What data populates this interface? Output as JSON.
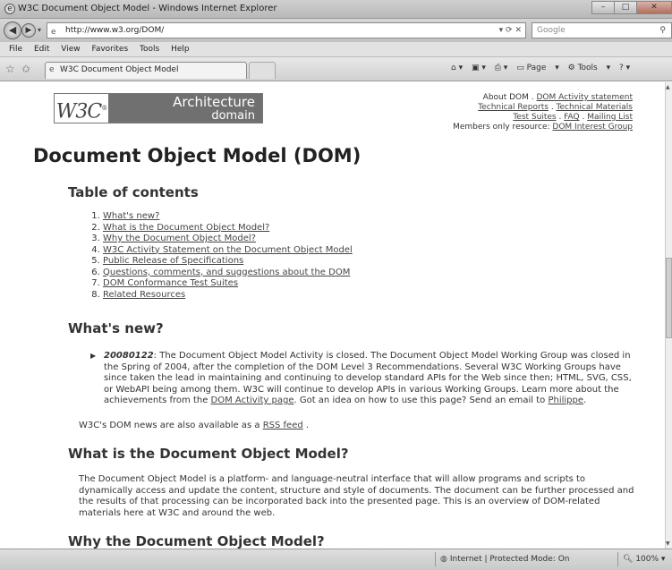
{
  "window": {
    "title": "W3C Document Object Model - Windows Internet Explorer",
    "controls": [
      "–",
      "□",
      "✕"
    ]
  },
  "address_bar": {
    "url": "http://www.w3.org/DOM/",
    "search_placeholder": "Google"
  },
  "menu": [
    "File",
    "Edit",
    "View",
    "Favorites",
    "Tools",
    "Help"
  ],
  "tab": {
    "label": "W3C Document Object Model"
  },
  "command_bar": {
    "page_label": "Page",
    "tools_label": "Tools"
  },
  "page": {
    "logo": {
      "w3c": "W3C",
      "line1": "Architecture",
      "line2": "domain"
    },
    "top_links": {
      "about": "About DOM",
      "activity": "DOM Activity statement",
      "tech_reports": "Technical Reports",
      "tech_materials": "Technical Materials",
      "test_suites": "Test Suites",
      "faq": "FAQ",
      "mailing": "Mailing List",
      "members_label": "Members only resource:",
      "interest_group": "DOM Interest Group"
    },
    "title": "Document Object Model (DOM)",
    "toc_heading": "Table of contents",
    "toc": [
      "What's new?",
      "What is the Document Object Model?",
      "Why the Document Object Model?",
      "W3C Activity Statement on the Document Object Model",
      "Public Release of Specifications",
      "Questions, comments, and suggestions about the DOM",
      "DOM Conformance Test Suites",
      "Related Resources"
    ],
    "whats_new_heading": "What's new?",
    "news": {
      "date": "20080122",
      "text1": ": The Document Object Model Activity is closed. The Document Object Model Working Group was closed in the Spring of 2004, after the completion of the DOM Level 3 Recommendations. Several W3C Working Groups have since taken the lead in maintaining and continuing to develop standard APIs for the Web since then; HTML, SVG, CSS, or WebAPI being among them. W3C will continue to develop APIs in various Working Groups. Learn more about the achievements from the ",
      "link1": "DOM Activity page",
      "text2": ". Got an idea on how to use this page? Send an email to ",
      "link2": "Philippe",
      "text3": "."
    },
    "rss": {
      "prefix": "W3C's DOM news are also available as a ",
      "link": "RSS feed",
      "suffix": " ."
    },
    "what_is_heading": "What is the Document Object Model?",
    "what_is_text": "The Document Object Model is a platform- and language-neutral interface that will allow programs and scripts to dynamically access and update the content, structure and style of documents. The document can be further processed and the results of that processing can be incorporated back into the presented page. This is an overview of DOM-related materials here at W3C and around the web.",
    "why_heading": "Why the Document Object Model?"
  },
  "status_bar": {
    "zone": "Internet | Protected Mode: On",
    "zoom": "100%"
  }
}
